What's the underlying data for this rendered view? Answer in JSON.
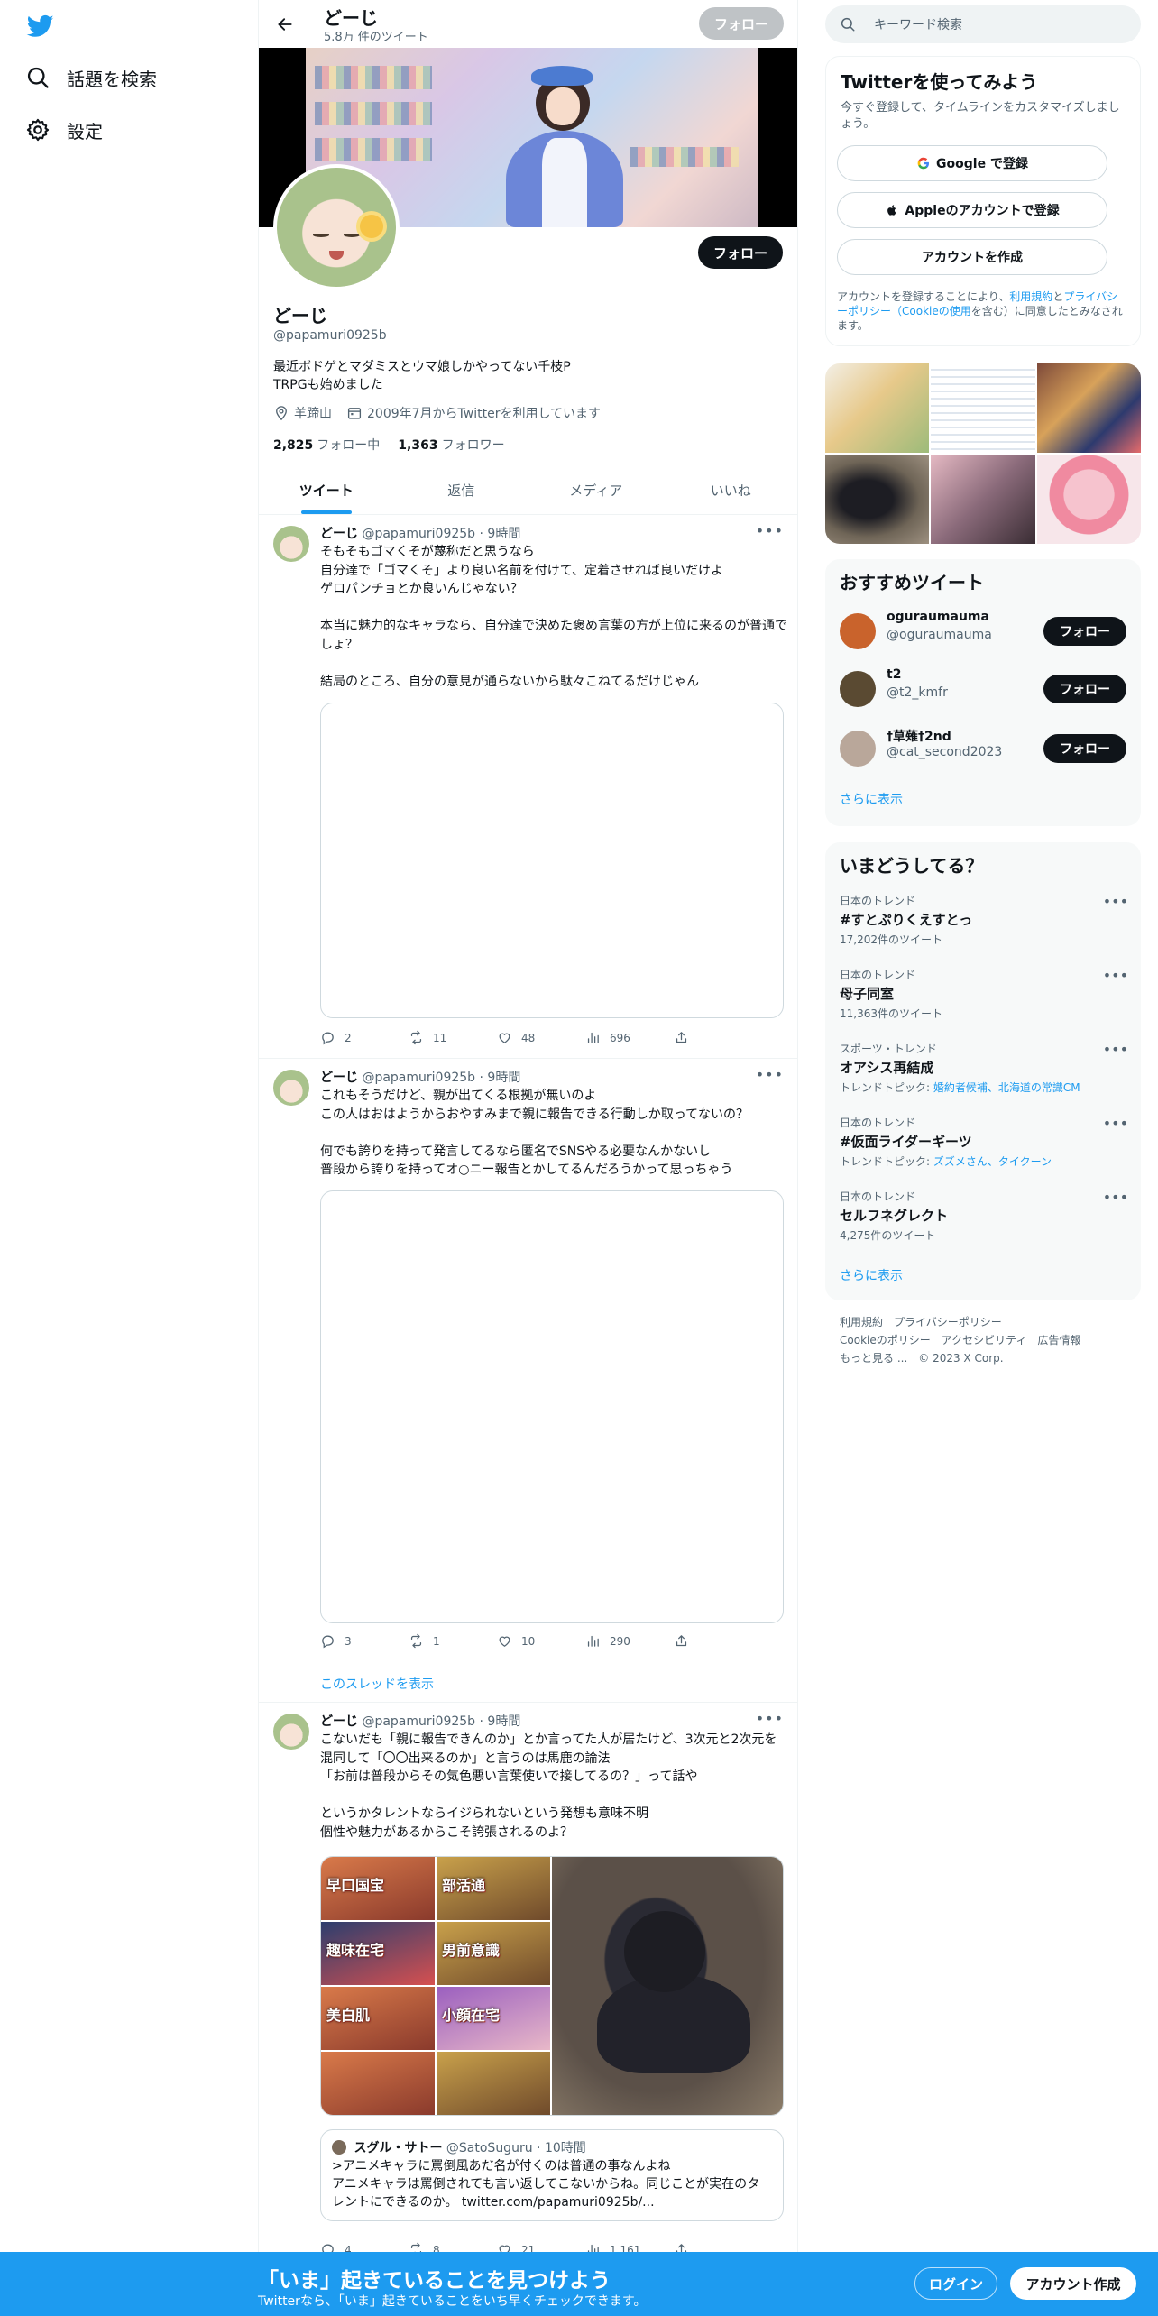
{
  "nav": {
    "explore_label": "話題を検索",
    "settings_label": "設定"
  },
  "topbar": {
    "name": "どーじ",
    "tweet_count": "5.8万 件のツイート",
    "follow_label": "フォロー"
  },
  "profile": {
    "name": "どーじ",
    "handle": "@papamuri0925b",
    "bio_line1": "最近ボドゲとマダミスとウマ娘しかやってない千枝P",
    "bio_line2": "TRPGも始めました",
    "location": "羊蹄山",
    "joined": "2009年7月からTwitterを利用しています",
    "following_count": "2,825",
    "following_label": "フォロー中",
    "followers_count": "1,363",
    "followers_label": "フォロワー",
    "follow_label": "フォロー"
  },
  "tabs": [
    "ツイート",
    "返信",
    "メディア",
    "いいね"
  ],
  "tweets": [
    {
      "name": "どーじ",
      "handle": "@papamuri0925b",
      "time": "9時間",
      "text": "そもそもゴマくそが蔑称だと思うなら\n自分達で「ゴマくそ」より良い名前を付けて、定着させれば良いだけよ\nゲロパンチョとか良いんじゃない？\n\n本当に魅力的なキャラなら、自分達で決めた褒め言葉の方が上位に来るのが普通でしょ？\n\n結局のところ、自分の意見が通らないから駄々こねてるだけじゃん",
      "replies": "2",
      "retweets": "11",
      "likes": "48",
      "views": "696"
    },
    {
      "name": "どーじ",
      "handle": "@papamuri0925b",
      "time": "9時間",
      "text": "これもそうだけど、親が出てくる根拠が無いのよ\nこの人はおはようからおやすみまで親に報告できる行動しか取ってないの？\n\n何でも誇りを持って発言してるなら匿名でSNSやる必要なんかないし\n普段から誇りを持ってオ○ニー報告とかしてるんだろうかって思っちゃう",
      "replies": "3",
      "retweets": "1",
      "likes": "10",
      "views": "290",
      "thread_link": "このスレッドを表示"
    },
    {
      "name": "どーじ",
      "handle": "@papamuri0925b",
      "time": "9時間",
      "text": "こないだも「親に報告できんのか」とか言ってた人が居たけど、3次元と2次元を混同して「〇〇出来るのか」と言うのは馬鹿の論法\n「お前は普段からその気色悪い言葉使いで接してるの？」って話や\n\nというかタレントならイジられないという発想も意味不明\n個性や魅力があるからこそ誇張されるのよ？",
      "collage_captions": [
        "早口国宝",
        "部活通",
        "趣味在宅",
        "男前意識",
        "美白肌",
        "小顔在宅"
      ],
      "quote": {
        "name": "スグル・サトー",
        "handle": "@SatoSuguru",
        "time": "10時間",
        "text": ">アニメキャラに罵倒風あだ名が付くのは普通の事なんよね\nアニメキャラは罵倒されても言い返してこないからね。同じことが実在のタレントにできるのか。 twitter.com/papamuri0925b/..."
      },
      "replies": "4",
      "retweets": "8",
      "likes": "21",
      "views": "1,161"
    }
  ],
  "side": {
    "search_placeholder": "キーワード検索",
    "signup": {
      "title": "Twitterを使ってみよう",
      "subtitle": "今すぐ登録して、タイムラインをカスタマイズしましょう。",
      "google_label": "Google で登録",
      "apple_label": "Appleのアカウントで登録",
      "create_label": "アカウントを作成",
      "legal_prefix": "アカウントを登録することにより、",
      "legal_terms": "利用規約",
      "legal_and": "と",
      "legal_privacy": "プライバシーポリシー（Cookieの使用",
      "legal_suffix": "を含む）に同意したとみなされます。"
    },
    "recommend": {
      "title": "おすすめツイート",
      "users": [
        {
          "name": "oguraumauma",
          "handle": "@oguraumauma",
          "follow": "フォロー",
          "color": "#c9632c"
        },
        {
          "name": "t2",
          "handle": "@t2_kmfr",
          "follow": "フォロー",
          "color": "#5a4a32"
        },
        {
          "name": "†草薙†2nd",
          "handle": "@cat_second2023",
          "follow": "フォロー",
          "color": "#b9a79a"
        }
      ],
      "more": "さらに表示"
    },
    "trends": {
      "title": "いまどうしてる？",
      "items": [
        {
          "context": "日本のトレンド",
          "title": "#すとぷりくえすとっ",
          "meta": "17,202件のツイート"
        },
        {
          "context": "日本のトレンド",
          "title": "母子同室",
          "meta": "11,363件のツイート"
        },
        {
          "context": "スポーツ・トレンド",
          "title": "オアシス再結成",
          "meta_prefix": "トレンドトピック: ",
          "meta_link": "婚約者候補、北海道の常識CM"
        },
        {
          "context": "日本のトレンド",
          "title": "#仮面ライダーギーツ",
          "meta_prefix": "トレンドトピック: ",
          "meta_link": "ズズメさん、タイクーン"
        },
        {
          "context": "日本のトレンド",
          "title": "セルフネグレクト",
          "meta": "4,275件のツイート"
        }
      ],
      "more": "さらに表示"
    },
    "footer": {
      "terms": "利用規約",
      "privacy": "プライバシーポリシー",
      "cookie": "Cookieのポリシー",
      "accessibility": "アクセシビリティ",
      "ads": "広告情報",
      "more": "もっと見る ...",
      "copyright": "© 2023 X Corp."
    }
  },
  "bottombar": {
    "title": "「いま」起きていることを見つけよう",
    "subtitle": "Twitterなら、「いま」起きていることをいち早くチェックできます。",
    "login": "ログイン",
    "signup": "アカウント作成"
  },
  "colors": {
    "accent": "#1d9bf0",
    "text": "#0f1419",
    "muted": "#536471"
  }
}
